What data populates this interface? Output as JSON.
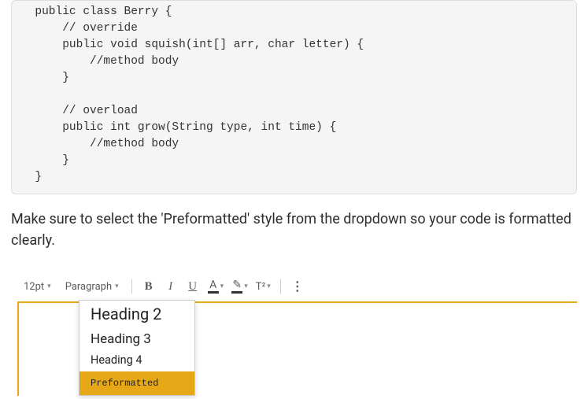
{
  "code": "  public class Berry {\n      // override\n      public void squish(int[] arr, char letter) {\n          //method body\n      }\n\n      // overload\n      public int grow(String type, int time) {\n          //method body\n      }\n  }",
  "instruction": "Make sure to select the 'Preformatted' style from the dropdown so your code is formatted clearly.",
  "toolbar": {
    "fontSize": "12pt",
    "styleLabel": "Paragraph",
    "bold": "B",
    "italic": "I",
    "underline": "U",
    "textColor": "A",
    "highlight": "✎",
    "superscript": "T²",
    "more": "⋮"
  },
  "dropdown": {
    "items": [
      {
        "label": "Heading 2",
        "cls": "h2"
      },
      {
        "label": "Heading 3",
        "cls": "h3"
      },
      {
        "label": "Heading 4",
        "cls": "h4"
      },
      {
        "label": "Preformatted",
        "cls": "pre"
      }
    ]
  }
}
